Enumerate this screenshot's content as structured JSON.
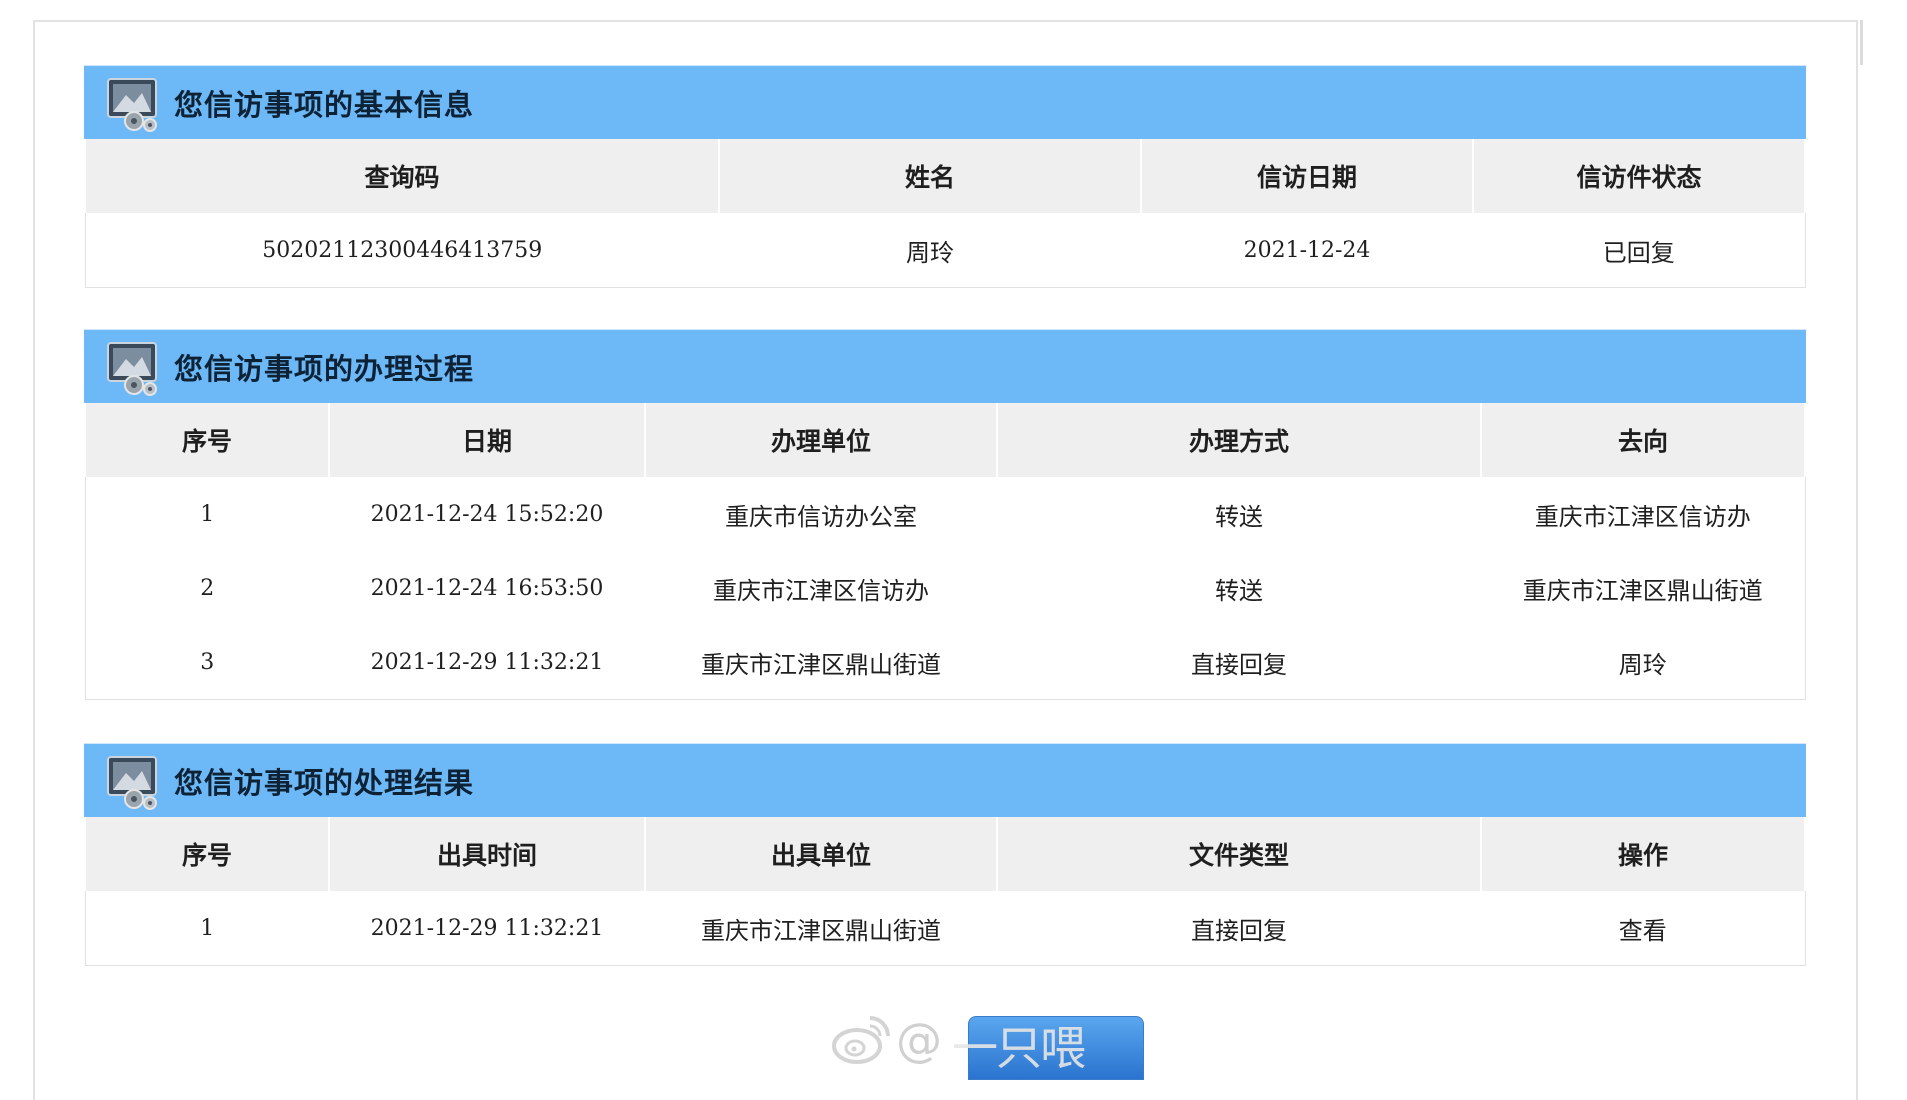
{
  "basic_info": {
    "title": "您信访事项的基本信息",
    "headers": [
      "查询码",
      "姓名",
      "信访日期",
      "信访件状态"
    ],
    "row": [
      "50202112300446413759",
      "周玲",
      "2021-12-24",
      "已回复"
    ]
  },
  "process": {
    "title": "您信访事项的办理过程",
    "headers": [
      "序号",
      "日期",
      "办理单位",
      "办理方式",
      "去向"
    ],
    "rows": [
      [
        "1",
        "2021-12-24 15:52:20",
        "重庆市信访办公室",
        "转送",
        "重庆市江津区信访办"
      ],
      [
        "2",
        "2021-12-24 16:53:50",
        "重庆市江津区信访办",
        "转送",
        "重庆市江津区鼎山街道"
      ],
      [
        "3",
        "2021-12-29 11:32:21",
        "重庆市江津区鼎山街道",
        "直接回复",
        "周玲"
      ]
    ]
  },
  "result": {
    "title": "您信访事项的处理结果",
    "headers": [
      "序号",
      "出具时间",
      "出具单位",
      "文件类型",
      "操作"
    ],
    "rows": [
      [
        "1",
        "2021-12-29 11:32:21",
        "重庆市江津区鼎山街道",
        "直接回复",
        "查看"
      ]
    ]
  },
  "watermark": {
    "prefix": "@",
    "name": "一只喂"
  },
  "colors": {
    "section_header": "#6db8f7",
    "table_header": "#efefef",
    "button": "#2a74cf"
  },
  "icons": {
    "section_icon": "monitor-gears-icon",
    "watermark_icon": "weibo-logo-icon"
  }
}
